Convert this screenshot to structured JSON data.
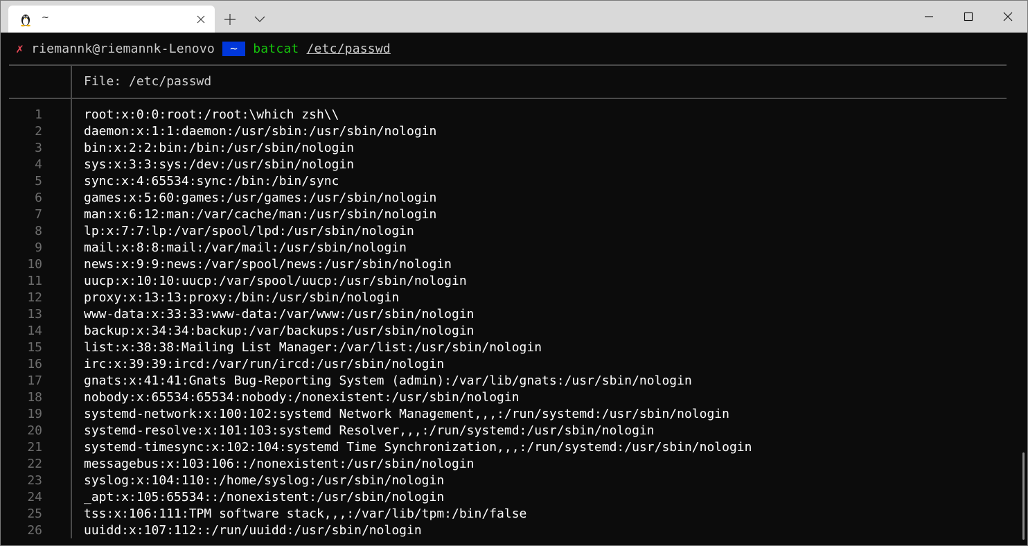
{
  "tab": {
    "title": "~",
    "icon": "linux-tux-icon"
  },
  "window_controls": {
    "minimize_icon": "minimize-icon",
    "maximize_icon": "maximize-icon",
    "close_icon": "close-icon"
  },
  "prompt": {
    "status_glyph": "✗",
    "user_host": "riemannk@riemannk-Lenovo",
    "segment_start": "",
    "dir": " ~ ",
    "segment_end": "",
    "command": "batcat",
    "argument": "/etc/passwd"
  },
  "file_header": "File: /etc/passwd",
  "lines": [
    {
      "n": "1",
      "text": "root:x:0:0:root:/root:\\which zsh\\\\"
    },
    {
      "n": "2",
      "text": "daemon:x:1:1:daemon:/usr/sbin:/usr/sbin/nologin"
    },
    {
      "n": "3",
      "text": "bin:x:2:2:bin:/bin:/usr/sbin/nologin"
    },
    {
      "n": "4",
      "text": "sys:x:3:3:sys:/dev:/usr/sbin/nologin"
    },
    {
      "n": "5",
      "text": "sync:x:4:65534:sync:/bin:/bin/sync"
    },
    {
      "n": "6",
      "text": "games:x:5:60:games:/usr/games:/usr/sbin/nologin"
    },
    {
      "n": "7",
      "text": "man:x:6:12:man:/var/cache/man:/usr/sbin/nologin"
    },
    {
      "n": "8",
      "text": "lp:x:7:7:lp:/var/spool/lpd:/usr/sbin/nologin"
    },
    {
      "n": "9",
      "text": "mail:x:8:8:mail:/var/mail:/usr/sbin/nologin"
    },
    {
      "n": "10",
      "text": "news:x:9:9:news:/var/spool/news:/usr/sbin/nologin"
    },
    {
      "n": "11",
      "text": "uucp:x:10:10:uucp:/var/spool/uucp:/usr/sbin/nologin"
    },
    {
      "n": "12",
      "text": "proxy:x:13:13:proxy:/bin:/usr/sbin/nologin"
    },
    {
      "n": "13",
      "text": "www-data:x:33:33:www-data:/var/www:/usr/sbin/nologin"
    },
    {
      "n": "14",
      "text": "backup:x:34:34:backup:/var/backups:/usr/sbin/nologin"
    },
    {
      "n": "15",
      "text": "list:x:38:38:Mailing List Manager:/var/list:/usr/sbin/nologin"
    },
    {
      "n": "16",
      "text": "irc:x:39:39:ircd:/var/run/ircd:/usr/sbin/nologin"
    },
    {
      "n": "17",
      "text": "gnats:x:41:41:Gnats Bug-Reporting System (admin):/var/lib/gnats:/usr/sbin/nologin"
    },
    {
      "n": "18",
      "text": "nobody:x:65534:65534:nobody:/nonexistent:/usr/sbin/nologin"
    },
    {
      "n": "19",
      "text": "systemd-network:x:100:102:systemd Network Management,,,:/run/systemd:/usr/sbin/nologin"
    },
    {
      "n": "20",
      "text": "systemd-resolve:x:101:103:systemd Resolver,,,:/run/systemd:/usr/sbin/nologin"
    },
    {
      "n": "21",
      "text": "systemd-timesync:x:102:104:systemd Time Synchronization,,,:/run/systemd:/usr/sbin/nologin"
    },
    {
      "n": "22",
      "text": "messagebus:x:103:106::/nonexistent:/usr/sbin/nologin"
    },
    {
      "n": "23",
      "text": "syslog:x:104:110::/home/syslog:/usr/sbin/nologin"
    },
    {
      "n": "24",
      "text": "_apt:x:105:65534::/nonexistent:/usr/sbin/nologin"
    },
    {
      "n": "25",
      "text": "tss:x:106:111:TPM software stack,,,:/var/lib/tpm:/bin/false"
    },
    {
      "n": "26",
      "text": "uuidd:x:107:112::/run/uuidd:/usr/sbin/nologin"
    }
  ]
}
